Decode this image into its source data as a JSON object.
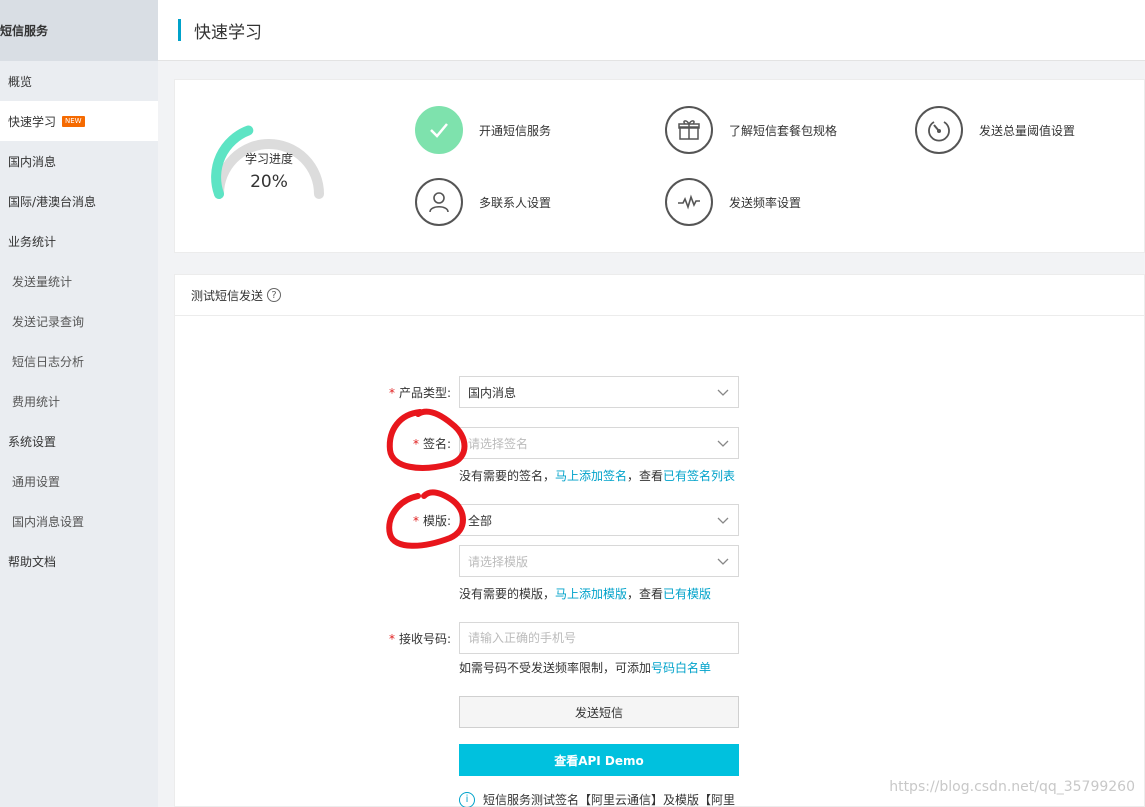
{
  "sidebar": {
    "header": "短信服务",
    "items": [
      {
        "label": "概览",
        "sub": false,
        "active": false
      },
      {
        "label": "快速学习",
        "sub": false,
        "active": true,
        "badge": "NEW"
      },
      {
        "label": "国内消息",
        "sub": false,
        "active": false
      },
      {
        "label": "国际/港澳台消息",
        "sub": false,
        "active": false
      },
      {
        "label": "业务统计",
        "sub": false,
        "active": false
      },
      {
        "label": "发送量统计",
        "sub": true,
        "active": false
      },
      {
        "label": "发送记录查询",
        "sub": true,
        "active": false
      },
      {
        "label": "短信日志分析",
        "sub": true,
        "active": false
      },
      {
        "label": "费用统计",
        "sub": true,
        "active": false
      },
      {
        "label": "系统设置",
        "sub": false,
        "active": false
      },
      {
        "label": "通用设置",
        "sub": true,
        "active": false
      },
      {
        "label": "国内消息设置",
        "sub": true,
        "active": false
      },
      {
        "label": "帮助文档",
        "sub": false,
        "active": false
      }
    ]
  },
  "header": {
    "title": "快速学习"
  },
  "progress": {
    "label": "学习进度",
    "value_text": "20%",
    "fraction": 0.2,
    "steps": [
      {
        "label": "开通短信服务",
        "icon": "check-icon",
        "done": true
      },
      {
        "label": "了解短信套餐包规格",
        "icon": "gift-icon",
        "done": false
      },
      {
        "label": "发送总量阈值设置",
        "icon": "gauge-icon",
        "done": false
      },
      {
        "label": "多联系人设置",
        "icon": "user-icon",
        "done": false
      },
      {
        "label": "发送频率设置",
        "icon": "pulse-icon",
        "done": false
      }
    ]
  },
  "test": {
    "title": "测试短信发送",
    "help": "?",
    "product_label": "产品类型:",
    "product_value": "国内消息",
    "sign_label": "签名:",
    "sign_placeholder": "请选择签名",
    "sign_hint_prefix": "没有需要的签名，",
    "sign_hint_link1": "马上添加签名",
    "sign_hint_mid": "，查看",
    "sign_hint_link2": "已有签名列表",
    "template_label": "模版:",
    "template_value": "全部",
    "template_placeholder": "请选择模版",
    "template_hint_prefix": "没有需要的模版，",
    "template_hint_link1": "马上添加模版",
    "template_hint_mid": "，查看",
    "template_hint_link2": "已有模版",
    "phone_label": "接收号码:",
    "phone_placeholder": "请输入正确的手机号",
    "phone_hint_prefix": "如需号码不受发送频率限制，可添加",
    "phone_hint_link": "号码白名单",
    "send_button": "发送短信",
    "demo_button": "查看API Demo",
    "info_text": "短信服务测试签名【阿里云通信】及模版【阿里",
    "required_mark": "*"
  },
  "watermark": "https://blog.csdn.net/qq_35799260",
  "colors": {
    "accent": "#00a2ca",
    "done": "#7ee2ad",
    "gauge": "#5de4c4",
    "demo_button": "#00c1de",
    "annotation": "#e8161c"
  }
}
